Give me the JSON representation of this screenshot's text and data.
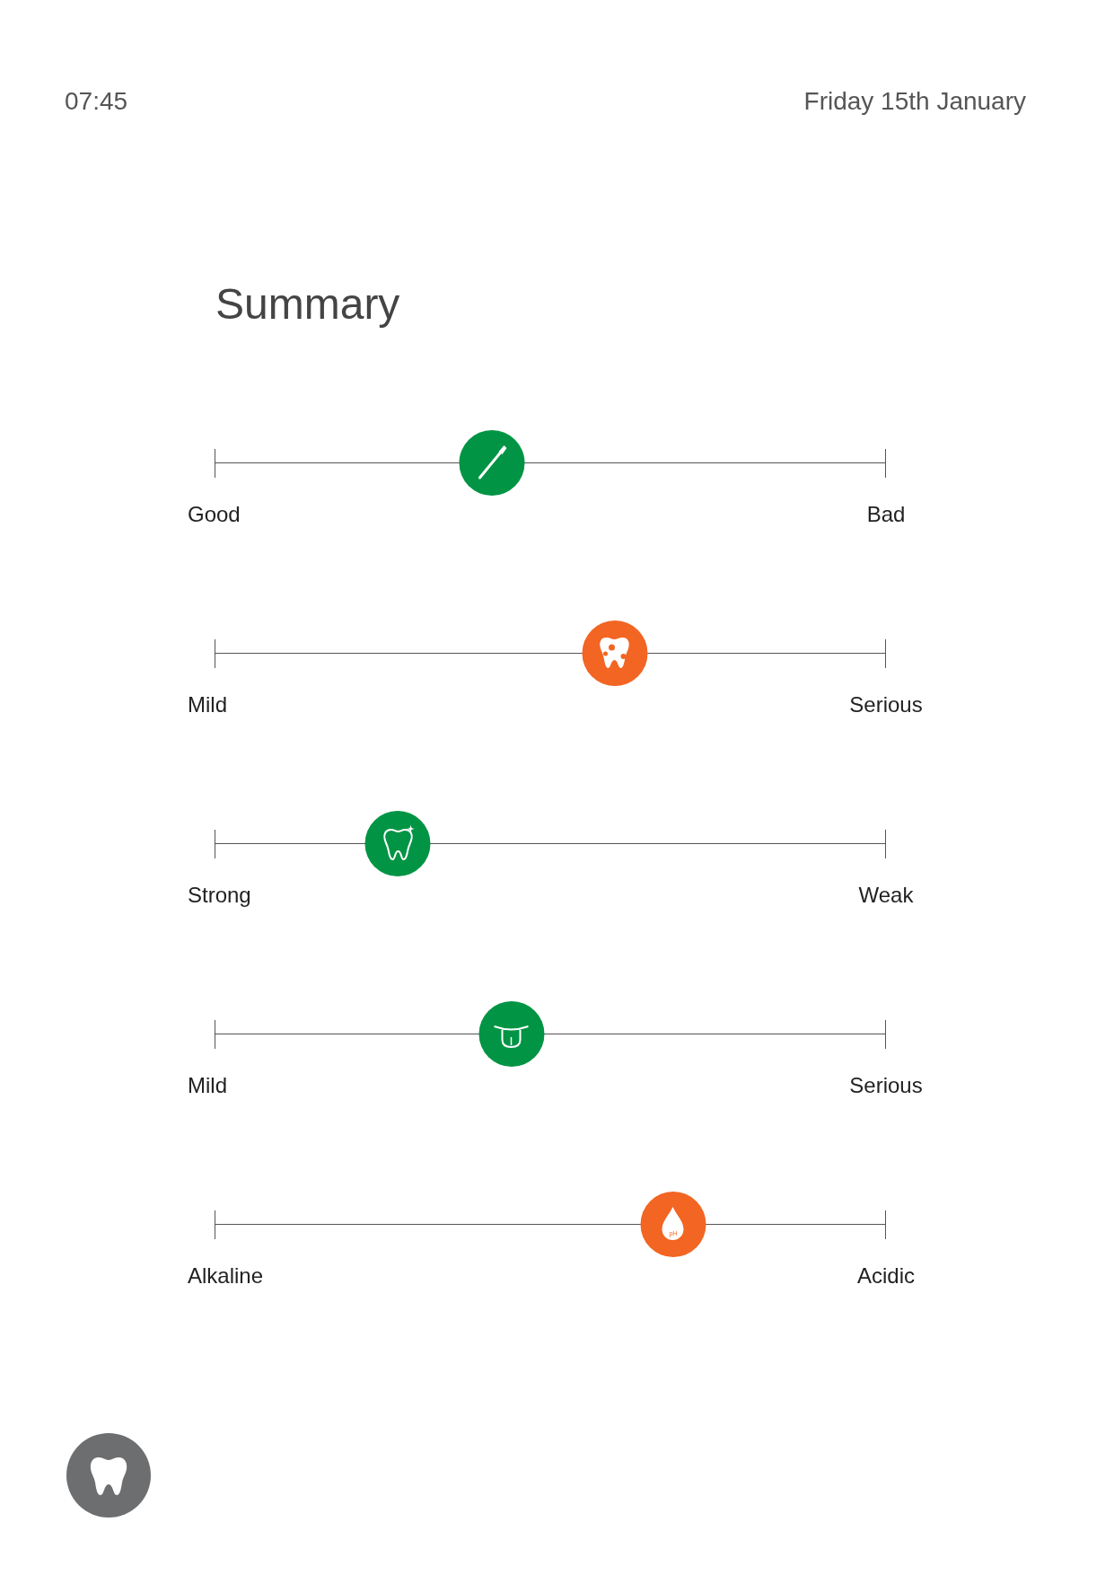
{
  "status": {
    "time": "07:45",
    "date": "Friday 15th January"
  },
  "title": "Summary",
  "scales": [
    {
      "kind": "toothbrush",
      "color": "#009444",
      "level": 0.413,
      "min_label": "Good",
      "max_label": "Bad"
    },
    {
      "kind": "decay",
      "color": "#f26522",
      "level": 0.596,
      "min_label": "Mild",
      "max_label": "Serious"
    },
    {
      "kind": "tooth",
      "color": "#009444",
      "level": 0.273,
      "min_label": "Strong",
      "max_label": "Weak"
    },
    {
      "kind": "tongue",
      "color": "#009444",
      "level": 0.442,
      "min_label": "Mild",
      "max_label": "Serious"
    },
    {
      "kind": "drop",
      "color": "#f26522",
      "level": 0.683,
      "min_label": "Alkaline",
      "max_label": "Acidic",
      "marker_text": "pH"
    }
  ]
}
